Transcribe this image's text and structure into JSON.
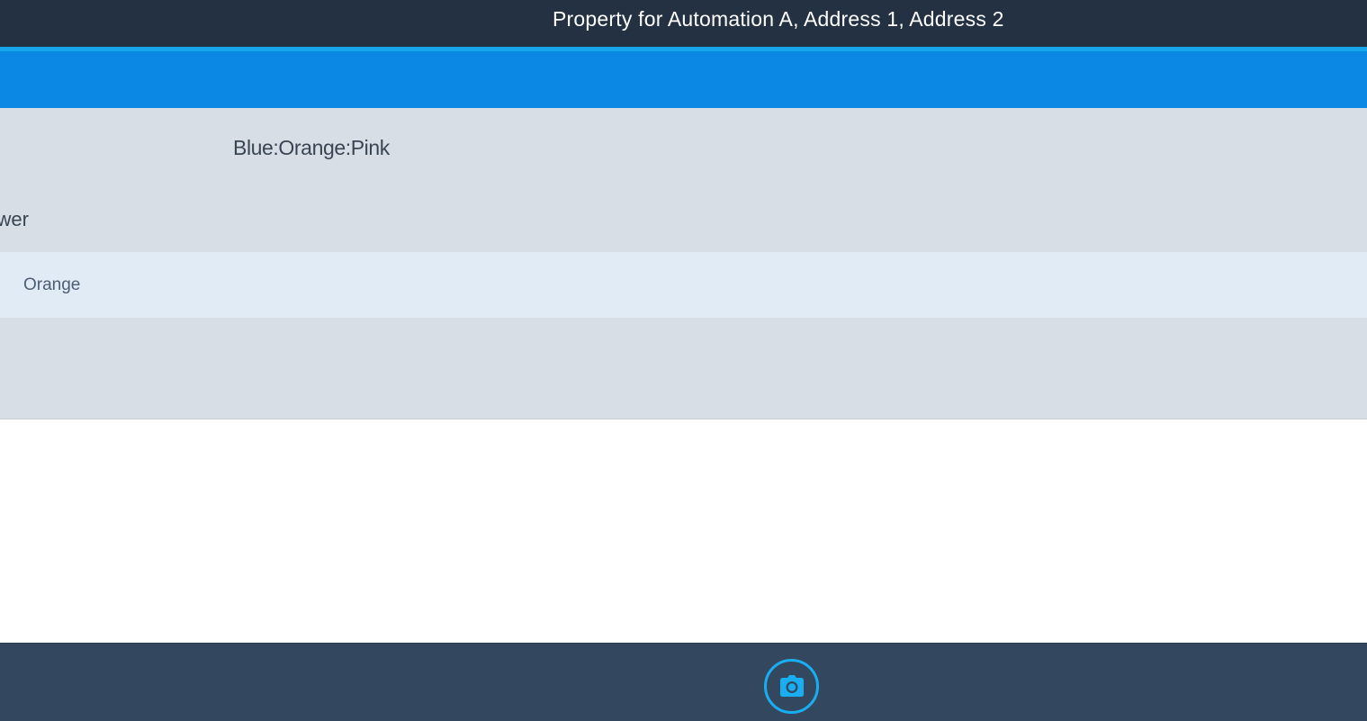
{
  "header": {
    "title": "Property for Automation A, Address 1, Address 2"
  },
  "detail": {
    "colors_value": "Blue:Orange:Pink",
    "field_label_partial": "wer",
    "selected_option": "Orange"
  },
  "footer": {
    "camera_icon": "camera-icon"
  },
  "colors": {
    "header_bg": "#233142",
    "accent": "#17a6ee",
    "band": "#0b87e4",
    "panel_bg": "#d7dee5",
    "option_bg": "#e1ebf5",
    "footer_bg": "#33485e"
  }
}
